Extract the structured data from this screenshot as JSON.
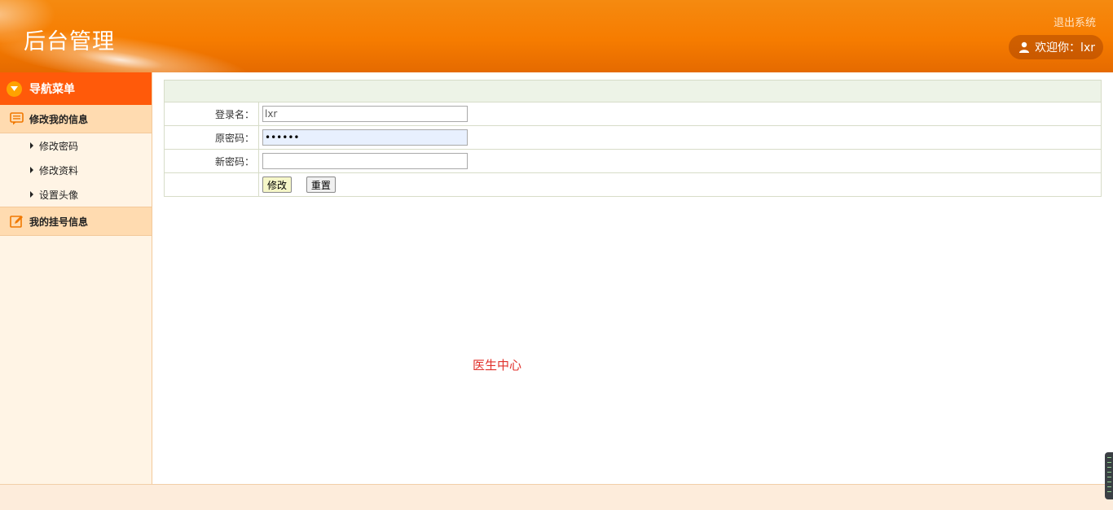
{
  "header": {
    "title": "后台管理",
    "logout_label": "退出系统",
    "welcome_text": "欢迎你：lxr"
  },
  "sidebar": {
    "nav_title": "导航菜单",
    "groups": [
      {
        "label": "修改我的信息",
        "items": [
          {
            "label": "修改密码"
          },
          {
            "label": "修改资料"
          },
          {
            "label": "设置头像"
          }
        ]
      },
      {
        "label": "我的挂号信息",
        "items": []
      }
    ]
  },
  "form": {
    "username_label": "登录名：",
    "username_value": "lxr",
    "old_password_label": "原密码：",
    "old_password_value": "••••••",
    "new_password_label": "新密码：",
    "new_password_value": "",
    "submit_label": "修改",
    "reset_label": "重置"
  },
  "center_text": "医生中心",
  "colors": {
    "header_orange": "#f67c00",
    "nav_head": "#ff5a0a",
    "group_bg": "#ffdbb0",
    "sidebar_bg": "#fff4e5",
    "center_text": "#e0312b"
  }
}
